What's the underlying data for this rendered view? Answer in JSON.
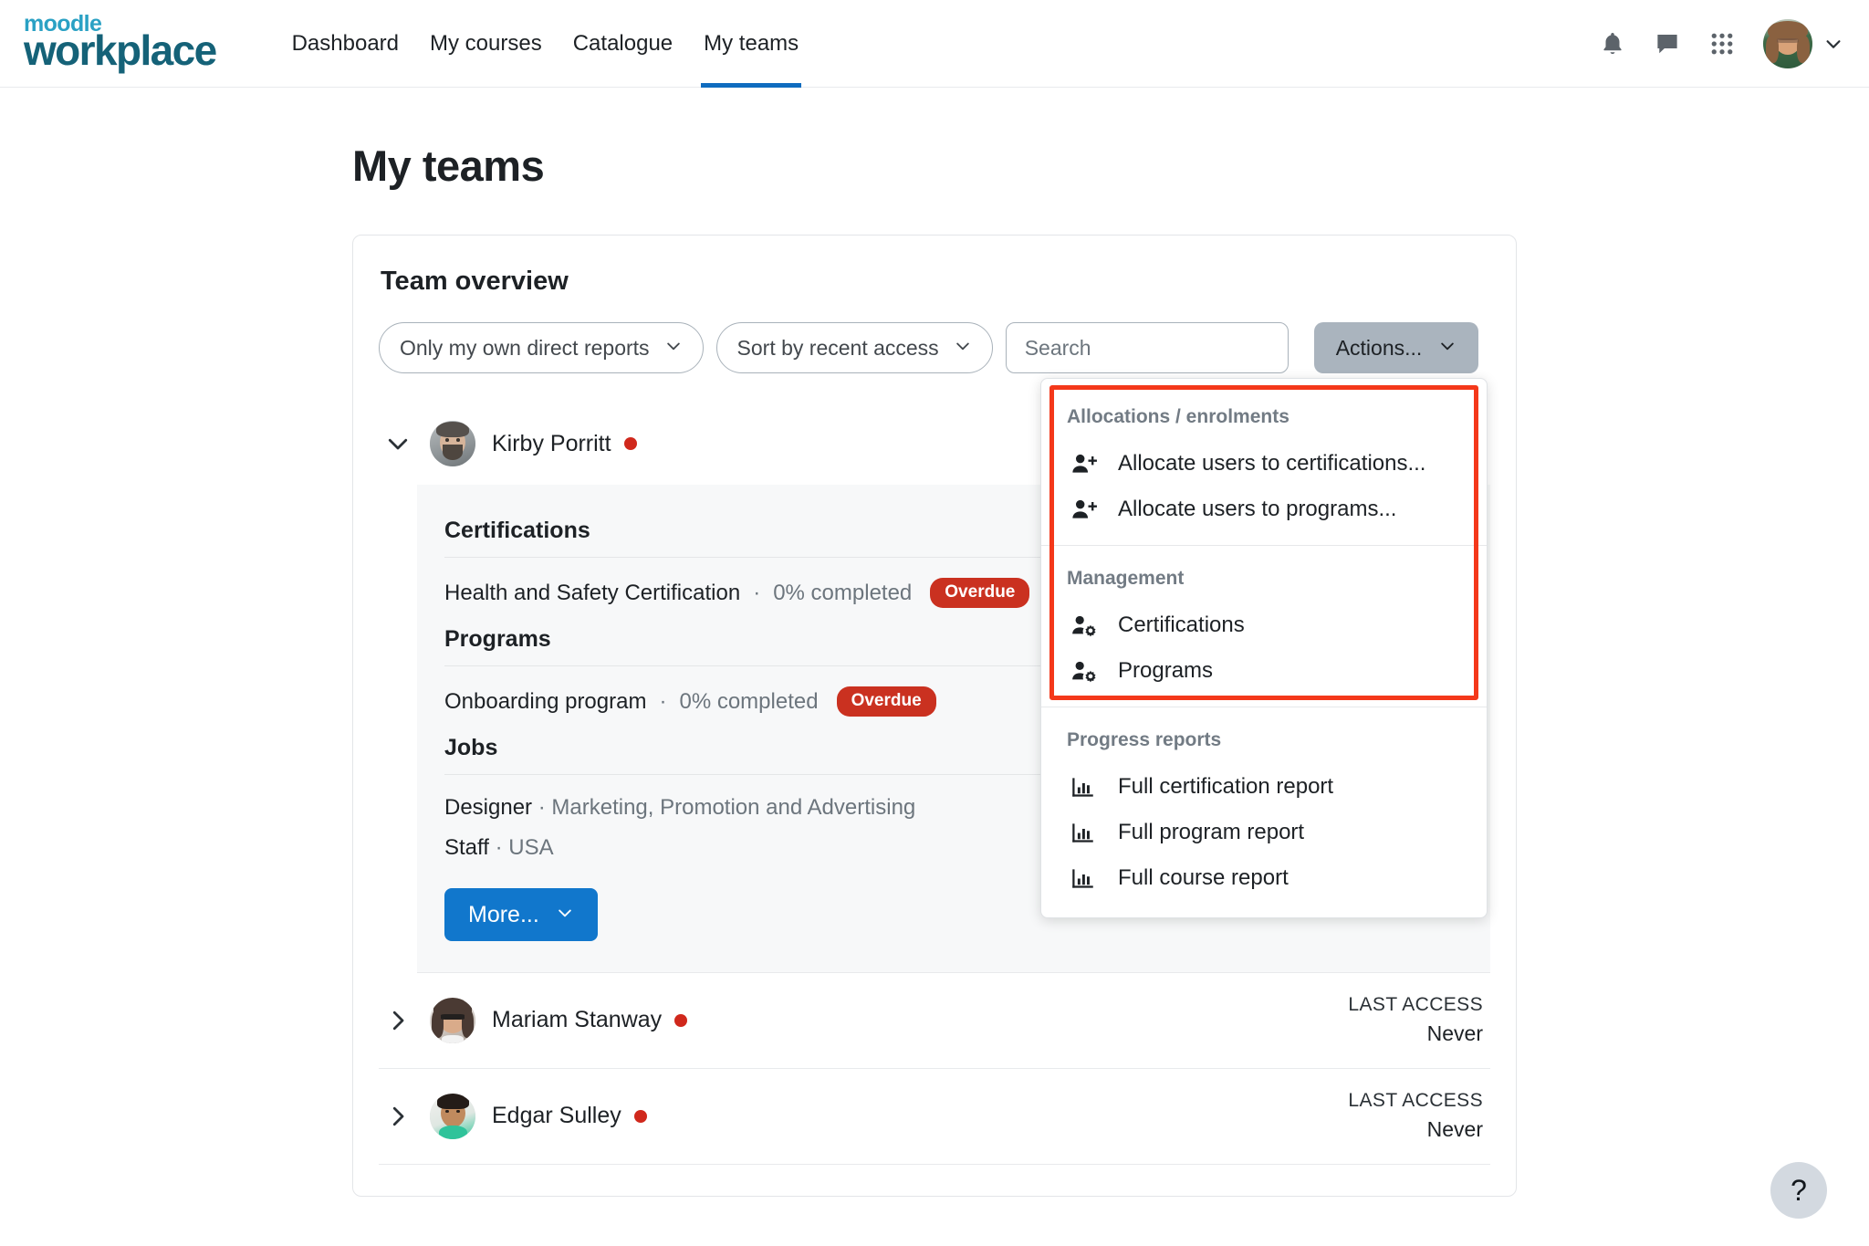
{
  "brand": {
    "top": "moodle",
    "bottom": "workplace"
  },
  "nav": {
    "links": [
      {
        "label": "Dashboard",
        "active": false
      },
      {
        "label": "My courses",
        "active": false
      },
      {
        "label": "Catalogue",
        "active": false
      },
      {
        "label": "My teams",
        "active": true
      }
    ],
    "icons": [
      "bell-icon",
      "message-icon",
      "apps-grid-icon"
    ],
    "avatar_alt": "User avatar"
  },
  "page": {
    "title": "My teams"
  },
  "card": {
    "title": "Team overview",
    "filters": {
      "scope": "Only my own direct reports",
      "sort": "Sort by recent access",
      "search_placeholder": "Search",
      "search_value": "",
      "actions_label": "Actions..."
    }
  },
  "dropdown": {
    "groups": [
      {
        "label": "Allocations / enrolments",
        "items": [
          {
            "label": "Allocate users to certifications...",
            "icon": "user-plus-icon"
          },
          {
            "label": "Allocate users to programs...",
            "icon": "user-plus-icon"
          }
        ]
      },
      {
        "label": "Management",
        "items": [
          {
            "label": "Certifications",
            "icon": "user-gear-icon"
          },
          {
            "label": "Programs",
            "icon": "user-gear-icon"
          }
        ]
      },
      {
        "label": "Progress reports",
        "items": [
          {
            "label": "Full certification report",
            "icon": "bar-chart-icon"
          },
          {
            "label": "Full program report",
            "icon": "bar-chart-icon"
          },
          {
            "label": "Full course report",
            "icon": "bar-chart-icon"
          }
        ]
      }
    ],
    "highlight_color": "#f4381a"
  },
  "team": {
    "expanded_member": {
      "name": "Kirby Porritt",
      "status": "red",
      "sections": {
        "certifications_heading": "Certifications",
        "certifications": [
          {
            "name": "Health and Safety Certification",
            "separator": "·",
            "progress": "0% completed",
            "badge": "Overdue"
          }
        ],
        "programs_heading": "Programs",
        "programs": [
          {
            "name": "Onboarding program",
            "separator": "·",
            "progress": "0% completed",
            "badge": "Overdue"
          }
        ],
        "jobs_heading": "Jobs",
        "jobs": [
          {
            "role": "Designer",
            "separator": "·",
            "detail": "Marketing, Promotion and Advertising"
          },
          {
            "role": "Staff",
            "separator": "·",
            "detail": "USA"
          }
        ]
      },
      "more_label": "More..."
    },
    "collapsed_members": [
      {
        "name": "Mariam Stanway",
        "status": "red",
        "last_access_label": "LAST ACCESS",
        "last_access_value": "Never"
      },
      {
        "name": "Edgar Sulley",
        "status": "red",
        "last_access_label": "LAST ACCESS",
        "last_access_value": "Never"
      }
    ]
  },
  "help": {
    "label": "?"
  },
  "colors": {
    "brand_light": "#2aa1c4",
    "brand_dark": "#156278",
    "accent_blue": "#0f6cbf",
    "button_blue": "#1177cc",
    "badge_red": "#ca3120",
    "status_red": "#d0281c",
    "highlight_red": "#f4381a",
    "actions_gray": "#aab4be"
  }
}
